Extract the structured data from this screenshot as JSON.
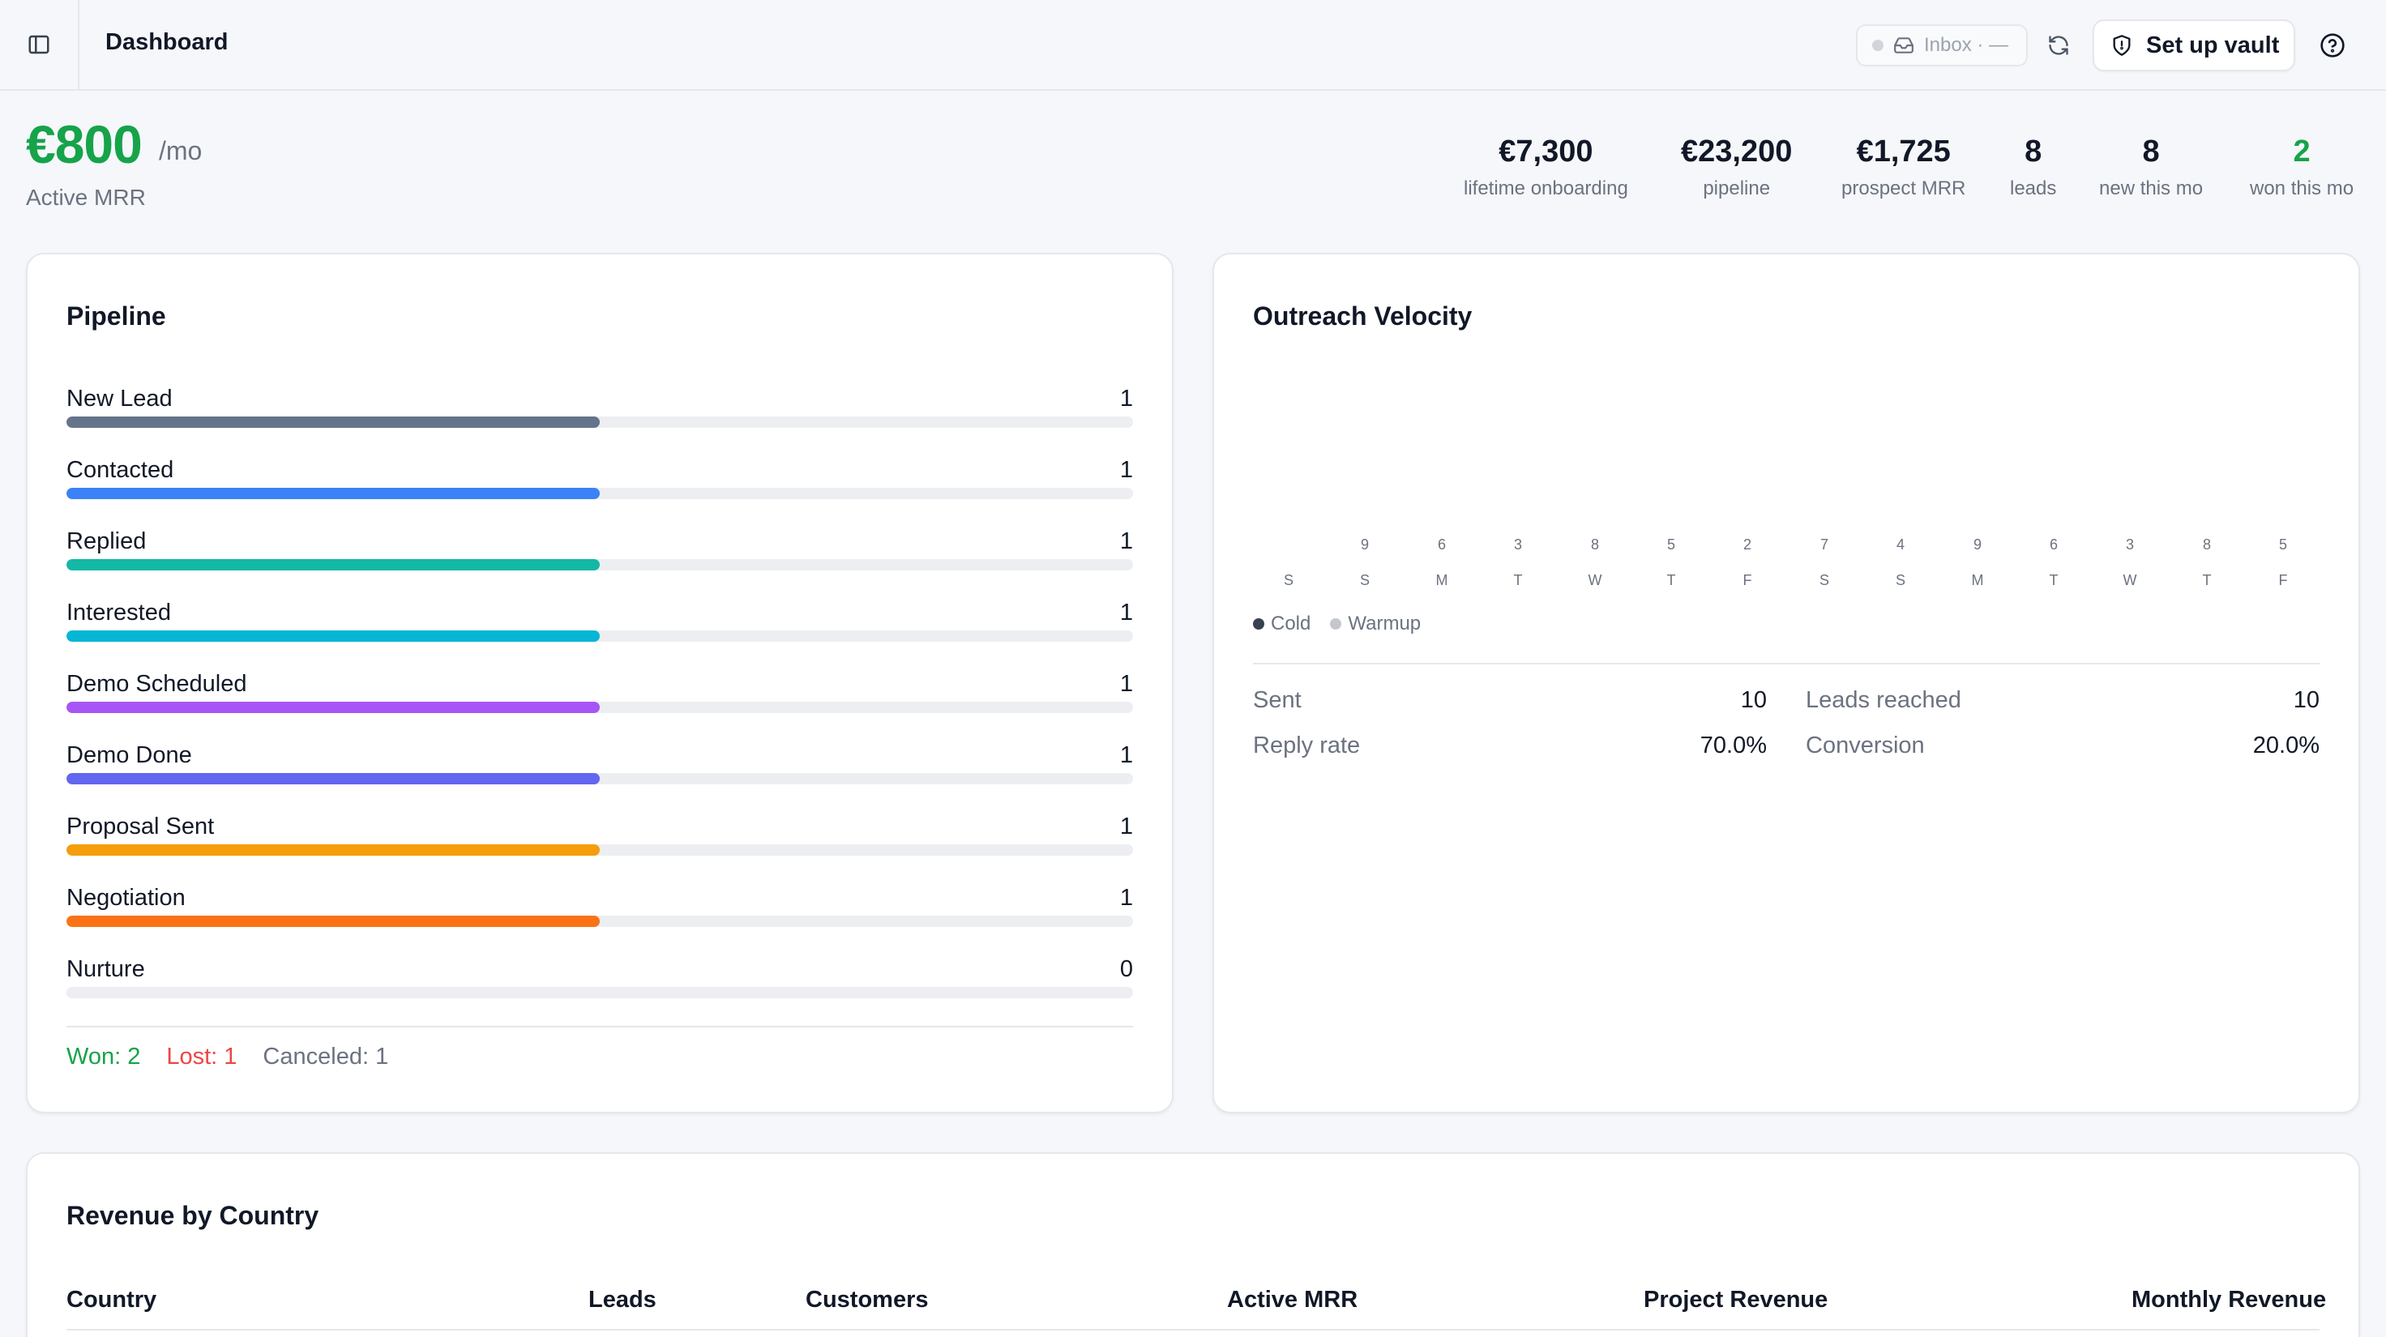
{
  "header": {
    "title": "Dashboard",
    "inbox_label": "Inbox · —",
    "vault_button": "Set up vault"
  },
  "mrr": {
    "value": "€800",
    "unit": "/mo",
    "label": "Active MRR"
  },
  "stats": [
    {
      "value": "€7,300",
      "label": "lifetime onboarding"
    },
    {
      "value": "€23,200",
      "label": "pipeline"
    },
    {
      "value": "€1,725",
      "label": "prospect MRR"
    },
    {
      "value": "8",
      "label": "leads"
    },
    {
      "value": "8",
      "label": "new this mo"
    },
    {
      "value": "2",
      "label": "won this mo"
    }
  ],
  "pipeline": {
    "title": "Pipeline",
    "stages": [
      {
        "name": "New Lead",
        "count": "1",
        "fraction": 0.5,
        "color": "#64748b"
      },
      {
        "name": "Contacted",
        "count": "1",
        "fraction": 0.5,
        "color": "#3b82f6"
      },
      {
        "name": "Replied",
        "count": "1",
        "fraction": 0.5,
        "color": "#14b8a6"
      },
      {
        "name": "Interested",
        "count": "1",
        "fraction": 0.5,
        "color": "#06b6d4"
      },
      {
        "name": "Demo Scheduled",
        "count": "1",
        "fraction": 0.5,
        "color": "#a855f7"
      },
      {
        "name": "Demo Done",
        "count": "1",
        "fraction": 0.5,
        "color": "#6366f1"
      },
      {
        "name": "Proposal Sent",
        "count": "1",
        "fraction": 0.5,
        "color": "#f59e0b"
      },
      {
        "name": "Negotiation",
        "count": "1",
        "fraction": 0.5,
        "color": "#f97316"
      },
      {
        "name": "Nurture",
        "count": "0",
        "fraction": 0,
        "color": "#94a3b8"
      }
    ],
    "won": "Won: 2",
    "lost": "Lost: 1",
    "canceled": "Canceled: 1",
    "colors": {
      "won": "#16a34a",
      "lost": "#ef4444",
      "canceled": "#6b7280"
    }
  },
  "velocity": {
    "title": "Outreach Velocity",
    "days": [
      {
        "count": "",
        "day": "S"
      },
      {
        "count": "9",
        "day": "S"
      },
      {
        "count": "6",
        "day": "M"
      },
      {
        "count": "3",
        "day": "T"
      },
      {
        "count": "8",
        "day": "W"
      },
      {
        "count": "5",
        "day": "T"
      },
      {
        "count": "2",
        "day": "F"
      },
      {
        "count": "7",
        "day": "S"
      },
      {
        "count": "4",
        "day": "S"
      },
      {
        "count": "9",
        "day": "M"
      },
      {
        "count": "6",
        "day": "T"
      },
      {
        "count": "3",
        "day": "W"
      },
      {
        "count": "8",
        "day": "T"
      },
      {
        "count": "5",
        "day": "F"
      }
    ],
    "legend": {
      "cold": "Cold",
      "warmup": "Warmup",
      "cold_color": "#374151",
      "warmup_color": "#c4c7cc"
    },
    "metrics": {
      "sent_label": "Sent",
      "sent": "10",
      "reply_label": "Reply rate",
      "reply": "70.0%",
      "leads_label": "Leads reached",
      "leads": "10",
      "conv_label": "Conversion",
      "conv": "20.0%"
    }
  },
  "revenue": {
    "title": "Revenue by Country",
    "columns": [
      "Country",
      "Leads",
      "Customers",
      "Active MRR",
      "Project Revenue",
      "Monthly Revenue"
    ]
  }
}
